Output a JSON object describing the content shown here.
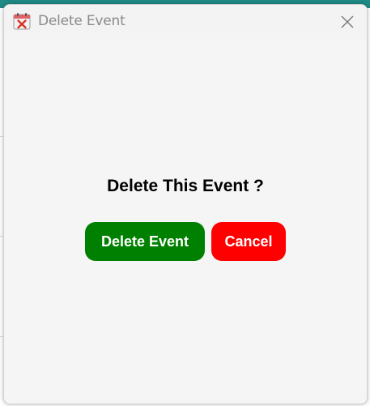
{
  "window": {
    "title": "Delete Event",
    "app_icon": "calendar-delete-icon",
    "close_icon": "close-icon"
  },
  "dialog": {
    "question": "Delete This Event ?",
    "delete_label": "Delete Event",
    "cancel_label": "Cancel"
  },
  "colors": {
    "delete_button": "#008000",
    "cancel_button": "#ff0000",
    "accent_teal": "#1f8a86"
  }
}
